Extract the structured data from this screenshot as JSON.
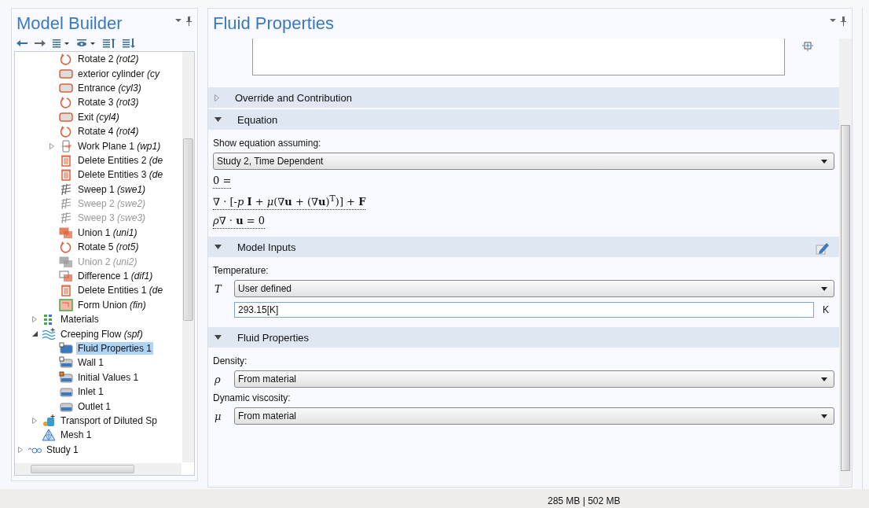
{
  "model_builder": {
    "title": "Model Builder",
    "tree": {
      "geometry_items": [
        {
          "label": "Rotate 2 *(rot2)*",
          "kind": "rotate",
          "disabled": false,
          "selected": false
        },
        {
          "label": "exterior cylinder *(cy*",
          "kind": "cylinder",
          "disabled": false,
          "selected": false
        },
        {
          "label": "Entrance *(cyl3)*",
          "kind": "cylinder",
          "disabled": false,
          "selected": false
        },
        {
          "label": "Rotate 3 *(rot3)*",
          "kind": "rotate",
          "disabled": false,
          "selected": false
        },
        {
          "label": "Exit *(cyl4)*",
          "kind": "cylinder",
          "disabled": false,
          "selected": false
        },
        {
          "label": "Rotate 4 *(rot4)*",
          "kind": "rotate",
          "disabled": false,
          "selected": false
        },
        {
          "label": "Work Plane 1 *(wp1)*",
          "kind": "workplane",
          "disabled": false,
          "selected": false,
          "expanded": false
        },
        {
          "label": "Delete Entities 2 *(de*",
          "kind": "delete",
          "disabled": false,
          "selected": false
        },
        {
          "label": "Delete Entities 3 *(de*",
          "kind": "delete",
          "disabled": false,
          "selected": false
        },
        {
          "label": "Sweep 1 *(swe1)*",
          "kind": "sweep",
          "disabled": false,
          "selected": false
        },
        {
          "label": "Sweep 2 *(swe2)*",
          "kind": "sweep",
          "disabled": true,
          "selected": false
        },
        {
          "label": "Sweep 3 *(swe3)*",
          "kind": "sweep",
          "disabled": true,
          "selected": false
        },
        {
          "label": "Union 1 *(uni1)*",
          "kind": "union",
          "disabled": false,
          "selected": false
        },
        {
          "label": "Rotate 5 *(rot5)*",
          "kind": "rotate",
          "disabled": false,
          "selected": false
        },
        {
          "label": "Union 2 *(uni2)*",
          "kind": "union",
          "disabled": true,
          "selected": false
        },
        {
          "label": "Difference 1 *(dif1)*",
          "kind": "difference",
          "disabled": false,
          "selected": false
        },
        {
          "label": "Delete Entities 1 *(de*",
          "kind": "delete",
          "disabled": false,
          "selected": false
        },
        {
          "label": "Form Union *(fin)*",
          "kind": "formunion",
          "disabled": false,
          "selected": false
        }
      ],
      "component_items": [
        {
          "label": "Materials",
          "kind": "materials",
          "disabled": false,
          "selected": false,
          "expanded": false
        },
        {
          "label": "Creeping Flow *(spf)*",
          "kind": "physics",
          "disabled": false,
          "selected": false,
          "expanded": true,
          "children": [
            {
              "label": "Fluid Properties 1",
              "kind": "domain",
              "disabled": false,
              "selected": true
            },
            {
              "label": "Wall 1",
              "kind": "wall",
              "disabled": false,
              "selected": false
            },
            {
              "label": "Initial Values 1",
              "kind": "initial",
              "disabled": false,
              "selected": false
            },
            {
              "label": "Inlet 1",
              "kind": "boundary",
              "disabled": false,
              "selected": false
            },
            {
              "label": "Outlet 1",
              "kind": "boundary",
              "disabled": false,
              "selected": false
            }
          ]
        },
        {
          "label": "Transport of Diluted Sp",
          "kind": "transport",
          "disabled": false,
          "selected": false,
          "expanded": false
        },
        {
          "label": "Mesh 1",
          "kind": "mesh",
          "disabled": false,
          "selected": false
        }
      ],
      "study_items": [
        {
          "label": "Study 1",
          "kind": "study",
          "disabled": false,
          "selected": false,
          "expanded": false
        }
      ]
    }
  },
  "settings": {
    "title": "Fluid Properties",
    "sections": [
      {
        "title": "Override and Contribution",
        "expanded": false
      },
      {
        "title": "Equation",
        "expanded": true
      },
      {
        "title": "Model Inputs",
        "expanded": true
      },
      {
        "title": "Fluid Properties",
        "expanded": true
      }
    ],
    "equation": {
      "label": "Show equation assuming:",
      "value": "Study 2, Time Dependent",
      "lines": [
        "0 =",
        "∇ · [-*p* **I** + *μ*(∇**u** + (∇**u**)$^{T}$)] + **F**",
        "*ρ*∇ · **u** = 0"
      ]
    },
    "model_inputs": {
      "label": "Temperature:",
      "symbol": "T",
      "value": "User defined",
      "field": "293.15[K]",
      "unit": "K"
    },
    "fluid_properties": [
      {
        "label": "Density:",
        "symbol": "ρ",
        "value": "From material"
      },
      {
        "label": "Dynamic viscosity:",
        "symbol": "μ",
        "value": "From material"
      }
    ]
  },
  "status_bar": {
    "memory": "285 MB | 502 MB"
  }
}
